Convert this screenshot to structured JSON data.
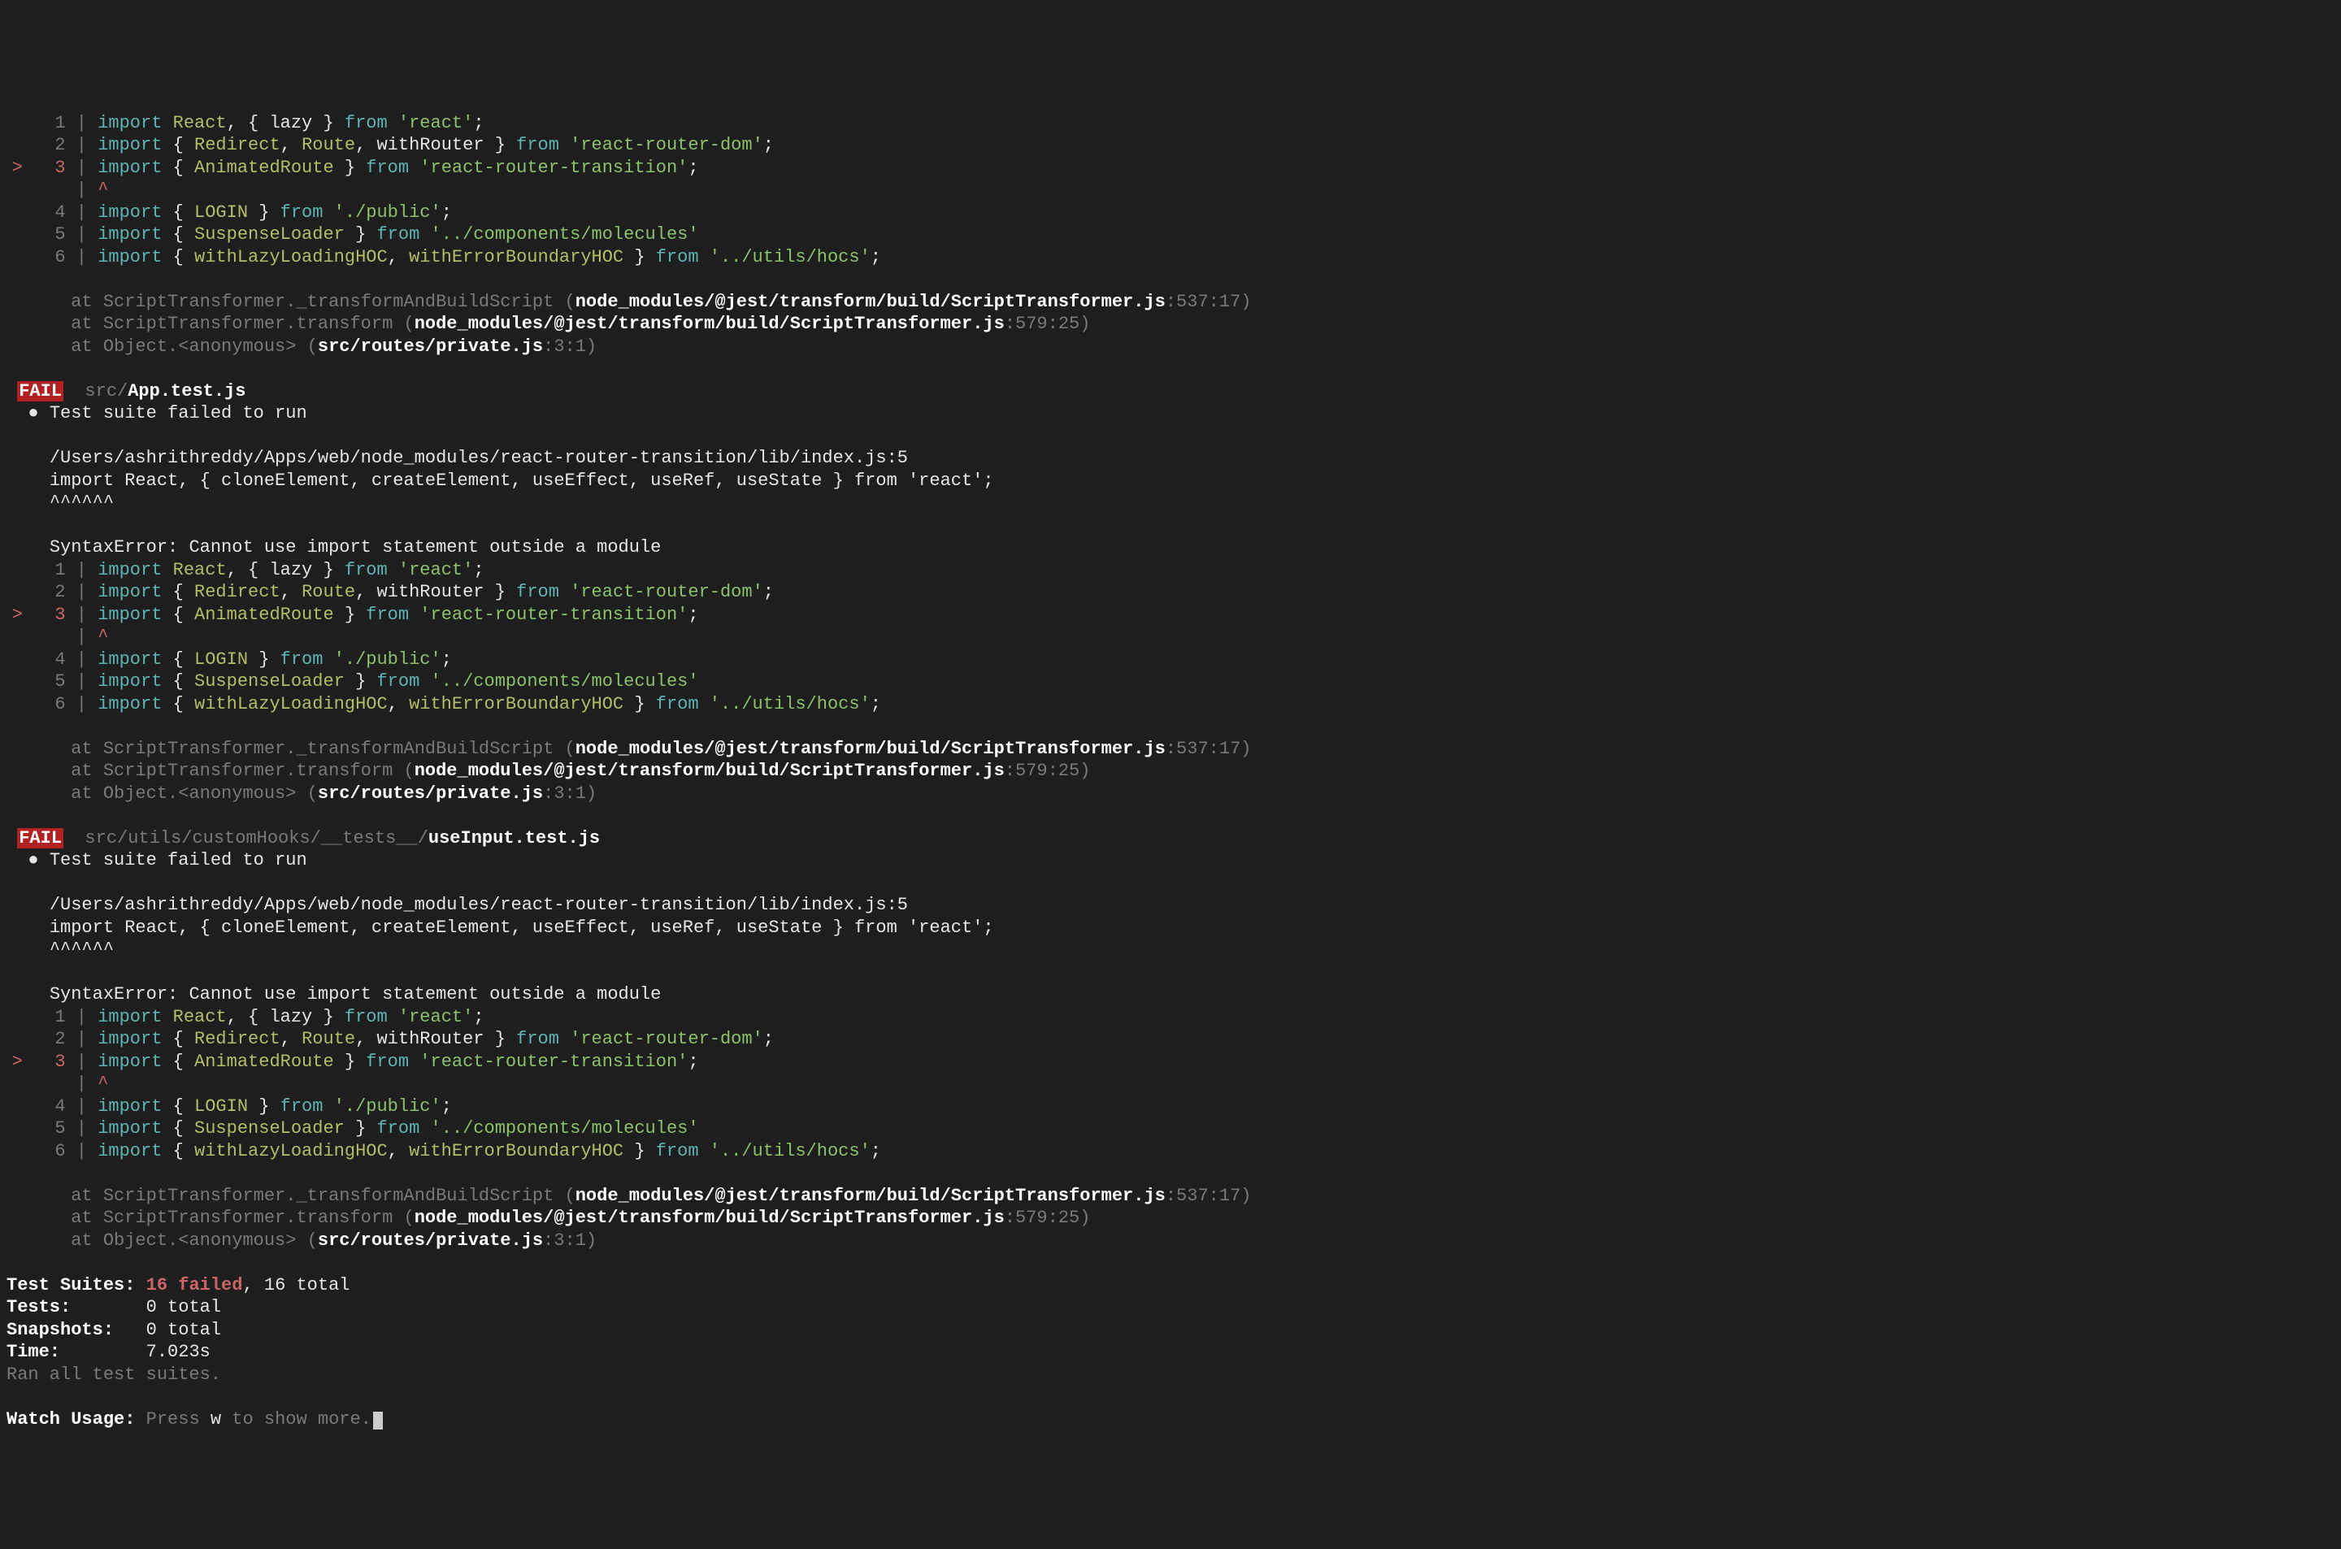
{
  "tests": [
    {
      "badge": "FAIL",
      "path_prefix": "src/",
      "path_bold": "App.test.js",
      "suite_msg": "Test suite failed to run",
      "file_path": "/Users/ashrithreddy/Apps/web/node_modules/react-router-transition/lib/index.js:5",
      "import_line": "import React, { cloneElement, createElement, useEffect, useRef, useState } from 'react';",
      "carets": "^^^^^^",
      "syntax_err": "SyntaxError: Cannot use import statement outside a module"
    },
    {
      "badge": "FAIL",
      "path_prefix": "src/utils/customHooks/__tests__/",
      "path_bold": "useInput.test.js",
      "suite_msg": "Test suite failed to run",
      "file_path": "/Users/ashrithreddy/Apps/web/node_modules/react-router-transition/lib/index.js:5",
      "import_line": "import React, { cloneElement, createElement, useEffect, useRef, useState } from 'react';",
      "carets": "^^^^^^",
      "syntax_err": "SyntaxError: Cannot use import statement outside a module"
    }
  ],
  "code": {
    "l1": {
      "kw": "import",
      "nm": "React",
      "brace": "{",
      "id": "lazy",
      "brace2": "}",
      "from": "from",
      "str": "'react'",
      "semi": ";"
    },
    "l2": {
      "kw": "import",
      "brace": "{",
      "id1": "Redirect",
      "id2": "Route",
      "rest": "withRouter }",
      "from": "from",
      "str": "'react-router-dom'",
      "semi": ";"
    },
    "l3": {
      "kw": "import",
      "brace": "{",
      "id": "AnimatedRoute",
      "brace2": "}",
      "from": "from",
      "str": "'react-router-transition'",
      "semi": ";"
    },
    "l4": {
      "kw": "import",
      "brace": "{",
      "id": "LOGIN",
      "brace2": "}",
      "from": "from",
      "str": "'./public'",
      "semi": ";"
    },
    "l5": {
      "kw": "import",
      "brace": "{",
      "id": "SuspenseLoader",
      "brace2": "}",
      "from": "from",
      "str": "'../components/molecules'"
    },
    "l6": {
      "kw": "import",
      "brace": "{",
      "id1": "withLazyLoadingHOC",
      "id2": "withErrorBoundaryHOC",
      "brace2": "}",
      "from": "from",
      "str": "'../utils/hocs'",
      "semi": ";"
    },
    "caret": "^"
  },
  "stack": {
    "s1": {
      "at": "at ScriptTransformer._transformAndBuildScript (",
      "file": "node_modules/@jest/transform/build/ScriptTransformer.js",
      "loc": ":537:17)"
    },
    "s2": {
      "at": "at ScriptTransformer.transform (",
      "file": "node_modules/@jest/transform/build/ScriptTransformer.js",
      "loc": ":579:25)"
    },
    "s3": {
      "at": "at Object.<anonymous> (",
      "file": "src/routes/private.js",
      "loc": ":3:1)"
    }
  },
  "summary": {
    "suites_label": "Test Suites:",
    "failed": "16 failed",
    "total": ", 16 total",
    "tests_label": "Tests:",
    "tests_val": "0 total",
    "snapshots_label": "Snapshots:",
    "snapshots_val": "0 total",
    "time_label": "Time:",
    "time_val": "7.023s",
    "ran": "Ran all test suites.",
    "watch_label": "Watch Usage:",
    "watch_press": " Press ",
    "watch_key": "w",
    "watch_rest": " to show more."
  },
  "linenos": {
    "n1": "1",
    "n2": "2",
    "n3": "3",
    "n4": "4",
    "n5": "5",
    "n6": "6",
    "gt": ">"
  }
}
